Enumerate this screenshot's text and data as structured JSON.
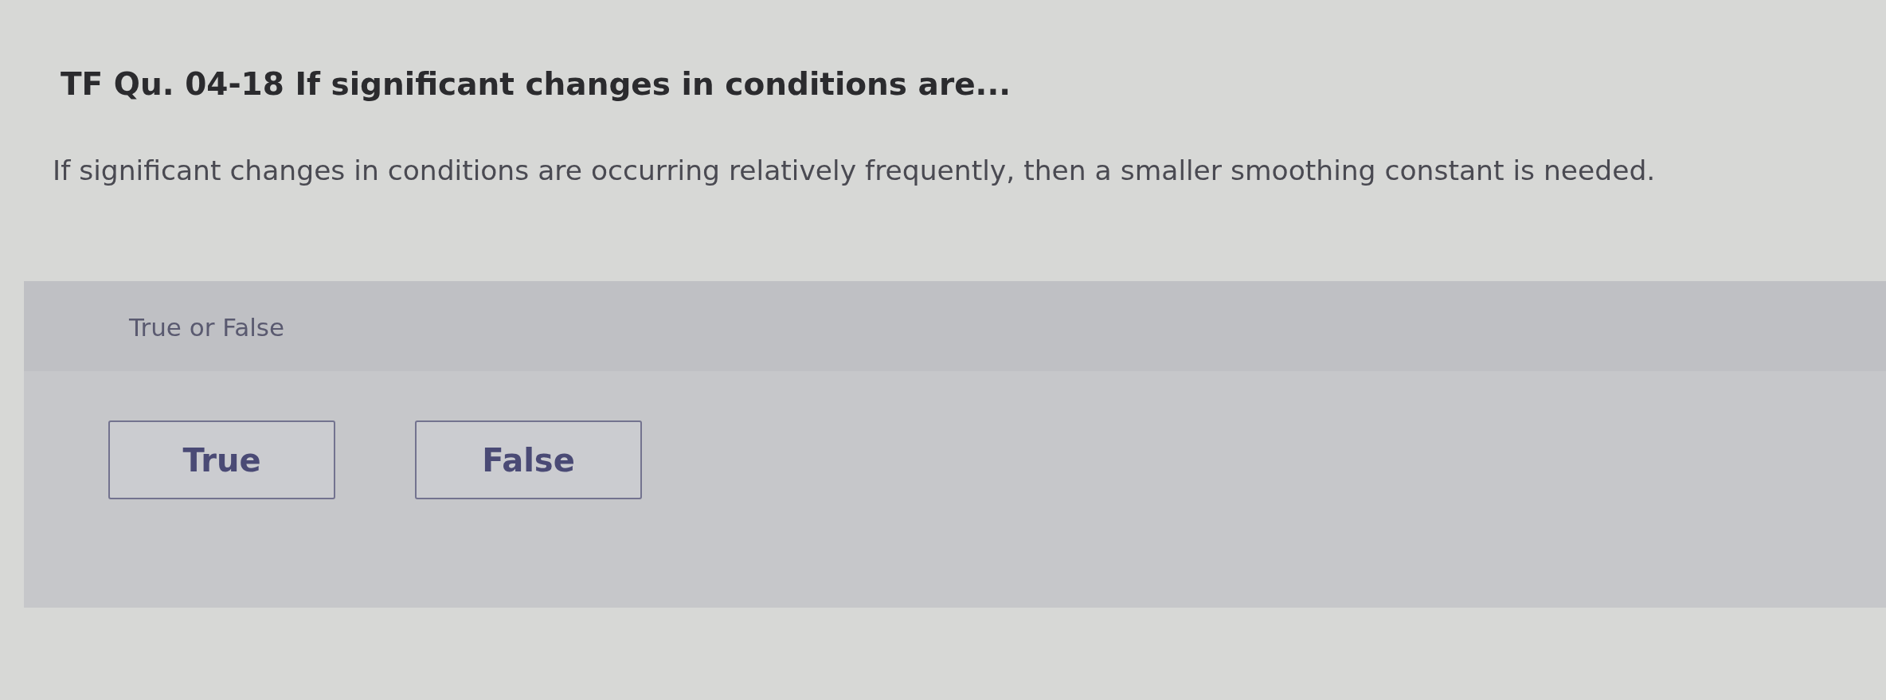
{
  "question": {
    "title": "TF Qu. 04-18 If significant changes in conditions are...",
    "prompt": "If significant changes in conditions are occurring relatively frequently, then a smaller smoothing constant is needed."
  },
  "answer_panel": {
    "label": "True or False",
    "options": [
      {
        "label": "True",
        "selected": false
      },
      {
        "label": "False",
        "selected": false
      }
    ]
  }
}
